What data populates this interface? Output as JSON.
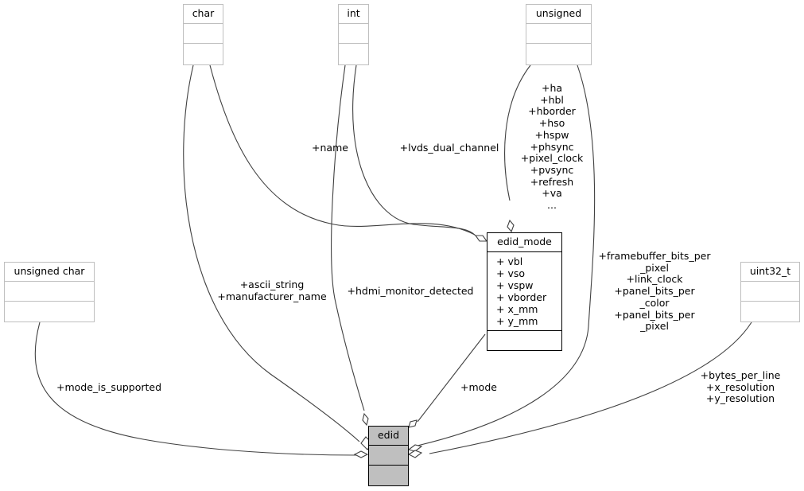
{
  "diagram": {
    "type": "collaboration-diagram",
    "focus_class": "edid",
    "nodes": {
      "char": {
        "title": "char"
      },
      "int": {
        "title": "int"
      },
      "unsigned": {
        "title": "unsigned"
      },
      "unsigned_char": {
        "title": "unsigned char"
      },
      "uint32_t": {
        "title": "uint32_t"
      },
      "edid_mode": {
        "title": "edid_mode",
        "attributes": [
          "+ vbl",
          "+ vso",
          "+ vspw",
          "+ vborder",
          "+ x_mm",
          "+ y_mm"
        ]
      },
      "edid": {
        "title": "edid"
      }
    },
    "edges": {
      "char_to_edid": {
        "from": "char",
        "to": "edid",
        "labels": [
          "+ascii_string",
          "+manufacturer_name"
        ]
      },
      "char_to_edid_mode": {
        "from": "char",
        "to": "edid_mode",
        "labels": [
          "+name"
        ]
      },
      "int_to_edid": {
        "from": "int",
        "to": "edid",
        "labels": [
          "+hdmi_monitor_detected"
        ]
      },
      "int_to_edid_mode": {
        "from": "int",
        "to": "edid_mode",
        "labels": [
          "+lvds_dual_channel"
        ]
      },
      "unsigned_to_edid_mode": {
        "from": "unsigned",
        "to": "edid_mode",
        "labels": [
          "+ha",
          "+hbl",
          "+hborder",
          "+hso",
          "+hspw",
          "+phsync",
          "+pixel_clock",
          "+pvsync",
          "+refresh",
          "+va",
          "..."
        ]
      },
      "unsigned_to_edid": {
        "from": "unsigned",
        "to": "edid",
        "labels": [
          "+framebuffer_bits_per",
          "_pixel",
          "+link_clock",
          "+panel_bits_per",
          "_color",
          "+panel_bits_per",
          "_pixel"
        ]
      },
      "unsigned_char_to_edid": {
        "from": "unsigned_char",
        "to": "edid",
        "labels": [
          "+mode_is_supported"
        ]
      },
      "uint32_t_to_edid": {
        "from": "uint32_t",
        "to": "edid",
        "labels": [
          "+bytes_per_line",
          "+x_resolution",
          "+y_resolution"
        ]
      },
      "edid_mode_to_edid": {
        "from": "edid_mode",
        "to": "edid",
        "labels": [
          "+mode"
        ]
      }
    }
  }
}
